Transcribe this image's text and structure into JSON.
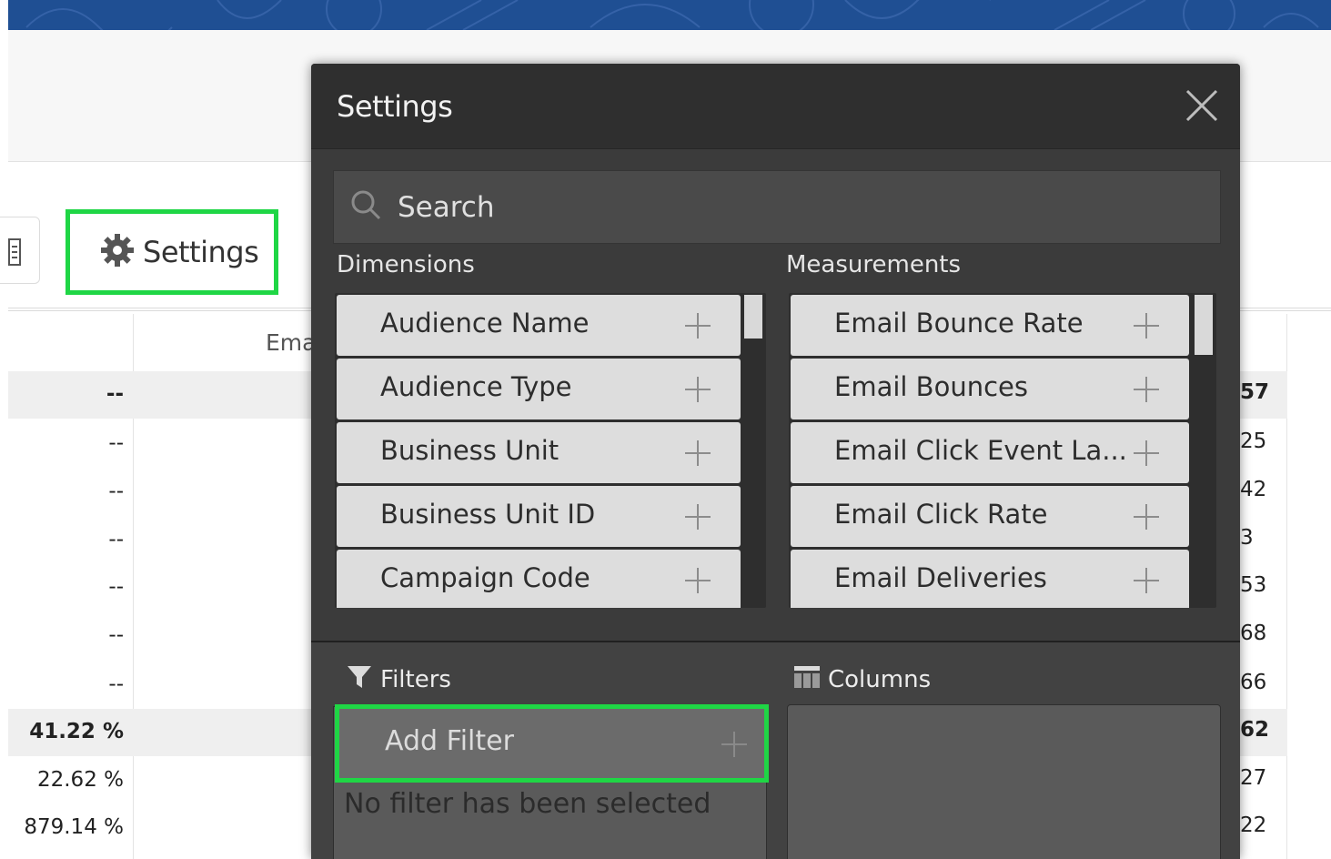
{
  "page": {
    "column_header_partial": "Ema",
    "settings_button_label": "Settings",
    "rows": [
      {
        "v1": "--",
        "v2": "57",
        "total": true
      },
      {
        "v1": "--",
        "v2": "25",
        "total": false
      },
      {
        "v1": "--",
        "v2": "42",
        "total": false
      },
      {
        "v1": "--",
        "v2": "3",
        "total": false
      },
      {
        "v1": "--",
        "v2": "53",
        "total": false
      },
      {
        "v1": "--",
        "v2": "68",
        "total": false
      },
      {
        "v1": "--",
        "v2": "66",
        "total": false
      },
      {
        "v1": "41.22 %",
        "v2": "62",
        "total": true
      },
      {
        "v1": "22.62 %",
        "v2": "27",
        "total": false
      },
      {
        "v1": "879.14 %",
        "v2": "22",
        "total": false
      }
    ]
  },
  "modal": {
    "title": "Settings",
    "search_placeholder": "Search",
    "dimensions_label": "Dimensions",
    "measurements_label": "Measurements",
    "dimensions": [
      "Audience Name",
      "Audience Type",
      "Business Unit",
      "Business Unit ID",
      "Campaign Code"
    ],
    "measurements": [
      "Email Bounce Rate",
      "Email Bounces",
      "Email Click Event La...",
      "Email Click Rate",
      "Email Deliveries"
    ],
    "filters_label": "Filters",
    "columns_label": "Columns",
    "add_filter_label": "Add Filter",
    "no_filter_text": "No filter has been selected"
  },
  "colors": {
    "highlight": "#1fd645",
    "banner": "#1f4f93",
    "modal_bg": "#3b3b3b"
  },
  "icons": {
    "settings": "gear-icon",
    "close": "close-icon",
    "search": "search-icon",
    "add": "plus-icon",
    "filter": "funnel-icon",
    "columns": "columns-icon"
  }
}
